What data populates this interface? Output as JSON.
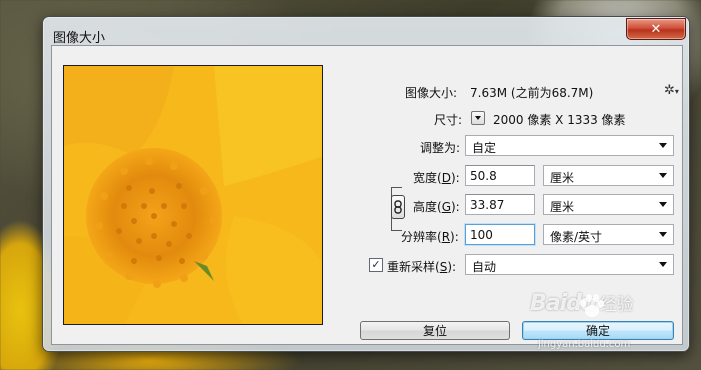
{
  "window": {
    "title": "图像大小",
    "close_glyph": "✕"
  },
  "info": {
    "size_label": "图像大小:",
    "size_value": "7.63M (之前为68.7M)",
    "dimensions_label": "尺寸:",
    "dimensions_value": "2000 像素  X  1333 像素"
  },
  "fit_to": {
    "label": "调整为:",
    "selected": "自定"
  },
  "width": {
    "label_prefix": "宽度(",
    "label_key": "D",
    "label_suffix": "):",
    "value": "50.8",
    "unit": "厘米"
  },
  "height": {
    "label_prefix": "高度(",
    "label_key": "G",
    "label_suffix": "):",
    "value": "33.87",
    "unit": "厘米"
  },
  "resolution": {
    "label_prefix": "分辨率(",
    "label_key": "R",
    "label_suffix": "):",
    "value": "100",
    "unit": "像素/英寸"
  },
  "resample": {
    "checked_glyph": "✓",
    "label_prefix": "重新采样(",
    "label_key": "S",
    "label_suffix": "):",
    "selected": "自动"
  },
  "buttons": {
    "reset": "复位",
    "ok": "确定"
  },
  "watermark": {
    "brand": "Baidu",
    "sub": "经验",
    "url": "jingyan.baidu.com"
  },
  "icons": {
    "gear": "gear-icon",
    "chain": "link-icon",
    "close": "close-icon"
  }
}
